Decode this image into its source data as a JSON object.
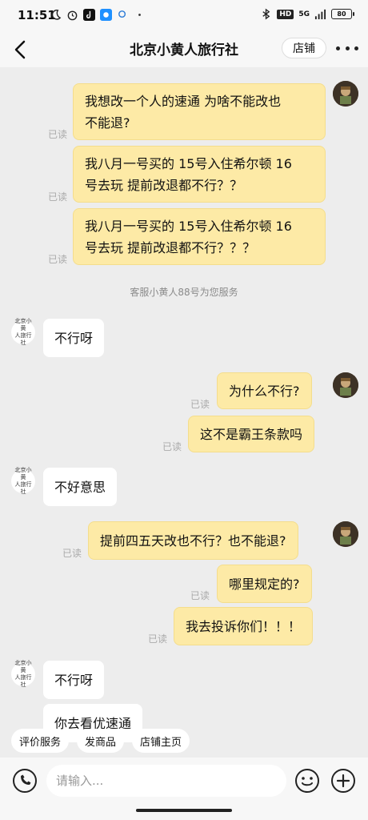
{
  "status_bar": {
    "time": "11:51",
    "network": "5G",
    "battery": "80"
  },
  "header": {
    "title": "北京小黄人旅行社",
    "store_label": "店铺"
  },
  "messages": [
    {
      "from": "me",
      "text": "我想改一个人的速通 为啥不能改也不能退?",
      "lines": [
        "我想改一个人的速通 为啥不能改也",
        "不能退?"
      ],
      "status": "已读"
    },
    {
      "from": "me",
      "lines": [
        "我八月一号买的 15号入住希尔顿 16",
        "号去玩 提前改退都不行？？"
      ],
      "status": "已读"
    },
    {
      "from": "me",
      "lines": [
        "我八月一号买的 15号入住希尔顿 16",
        "号去玩 提前改退都不行？？？"
      ],
      "status": "已读"
    },
    {
      "from": "system",
      "text": "客服小黄人88号为您服务"
    },
    {
      "from": "shop",
      "text": "不行呀"
    },
    {
      "from": "me",
      "text": "为什么不行?",
      "status": "已读"
    },
    {
      "from": "me",
      "text": "这不是霸王条款吗",
      "status": "已读"
    },
    {
      "from": "shop",
      "text": "不好意思"
    },
    {
      "from": "me",
      "text": "提前四五天改也不行？也不能退?",
      "status": "已读"
    },
    {
      "from": "me",
      "text": "哪里规定的?",
      "status": "已读"
    },
    {
      "from": "me",
      "text": "我去投诉你们！！！",
      "status": "已读"
    },
    {
      "from": "shop",
      "text": "不行呀"
    },
    {
      "from": "shop",
      "text": "你去看优速通"
    }
  ],
  "shop_avatar_text": "北京小黄人旅行社",
  "quick_actions": [
    "评价服务",
    "发商品",
    "店铺主页"
  ],
  "input": {
    "placeholder": "请输入..."
  }
}
